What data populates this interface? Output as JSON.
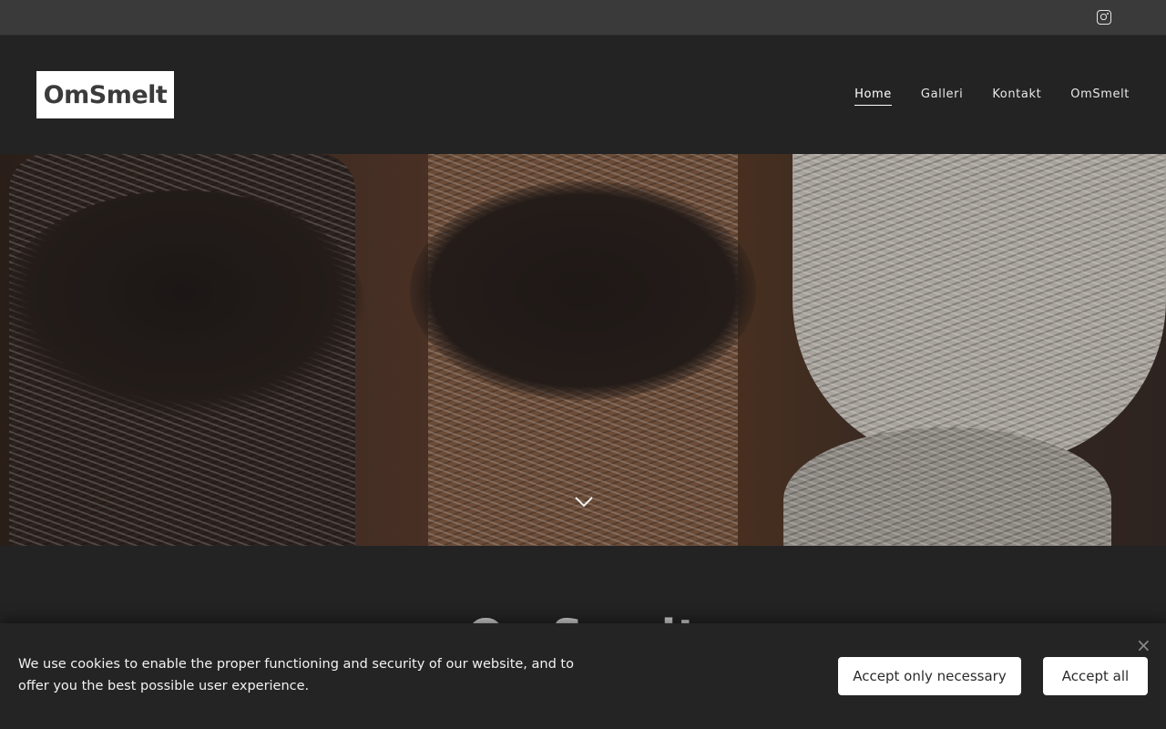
{
  "topbar": {
    "social_icon": "instagram-icon"
  },
  "header": {
    "logo_text": "OmSmelt",
    "nav": [
      {
        "label": "Home",
        "active": true
      },
      {
        "label": "Galleri",
        "active": false
      },
      {
        "label": "Kontakt",
        "active": false
      },
      {
        "label": "OmSmelt",
        "active": false
      }
    ]
  },
  "hero": {
    "scroll_icon": "chevron-down-icon"
  },
  "main": {
    "heading": "OmSmelt"
  },
  "cookie": {
    "text": "We use cookies to enable the proper functioning and security of our website, and to offer you the best possible user experience.",
    "close_icon": "close-icon",
    "accept_necessary_label": "Accept only necessary",
    "accept_all_label": "Accept all"
  },
  "colors": {
    "background": "#232323",
    "topbar": "#3a3a3a",
    "button": "#ffffff"
  }
}
